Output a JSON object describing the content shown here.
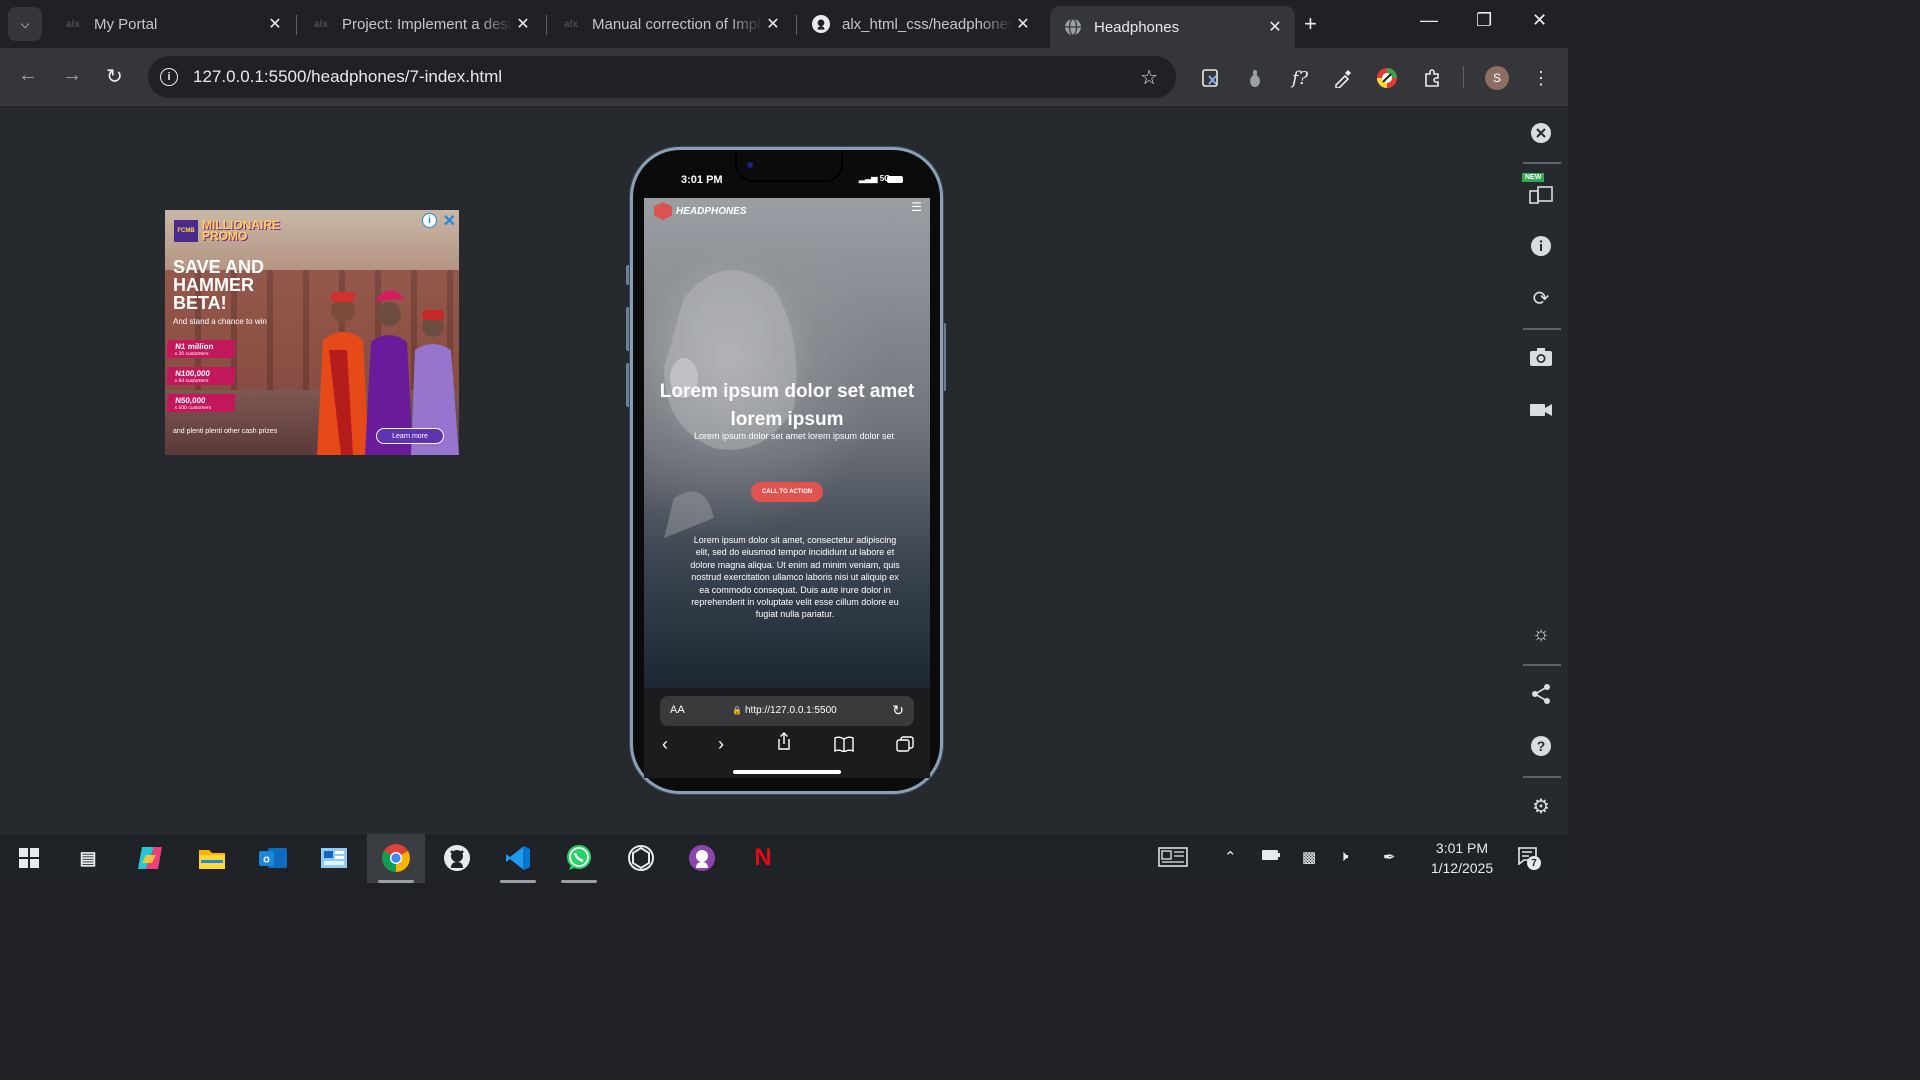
{
  "browser": {
    "tabs": [
      {
        "title": "My Portal",
        "favicon": "alx"
      },
      {
        "title": "Project: Implement a design",
        "favicon": "alx"
      },
      {
        "title": "Manual correction of Implement",
        "favicon": "alx"
      },
      {
        "title": "alx_html_css/headphones",
        "favicon": "github-icon"
      },
      {
        "title": "Headphones",
        "favicon": "globe-icon"
      }
    ],
    "url": "127.0.0.1:5500/headphones/7-index.html",
    "profile_initial": "S"
  },
  "ad": {
    "brand": "FCMB",
    "promo": "MILLIONAIRE PROMO",
    "headline": "SAVE AND HAMMER BETA!",
    "subline": "And stand a chance to win",
    "prizes": [
      {
        "amount": "N1 million",
        "note": "x 20 customers"
      },
      {
        "amount": "N100,000",
        "note": "x 64 customers"
      },
      {
        "amount": "N50,000",
        "note": "x 500 customers"
      }
    ],
    "footer": "and plenti plenti other cash prizes",
    "learn_more": "Learn more"
  },
  "phone": {
    "time": "3:01 PM",
    "network": "5G",
    "site": {
      "brand": "HEADPHONES",
      "headline": "Lorem ipsum dolor set amet lorem ipsum",
      "lead": "Lorem ipsum dolor set amet lorem ipsum dolor set",
      "cta": "CALL TO ACTION",
      "body": "Lorem ipsum dolor sit amet, consectetur adipiscing elit, sed do eiusmod tempor incididunt ut labore et dolore magna aliqua. Ut enim ad minim veniam, quis nostrud exercitation ullamco laboris nisi ut aliquip ex ea commodo consequat. Duis aute irure dolor in reprehenderit in voluptate velit esse cillum dolore eu fugiat nulla pariatur."
    },
    "safari": {
      "aa": "AA",
      "url": "http://127.0.0.1:5500"
    }
  },
  "devtools": {
    "new_badge": "NEW"
  },
  "taskbar": {
    "time": "3:01 PM",
    "date": "1/12/2025",
    "notifications": "7"
  }
}
